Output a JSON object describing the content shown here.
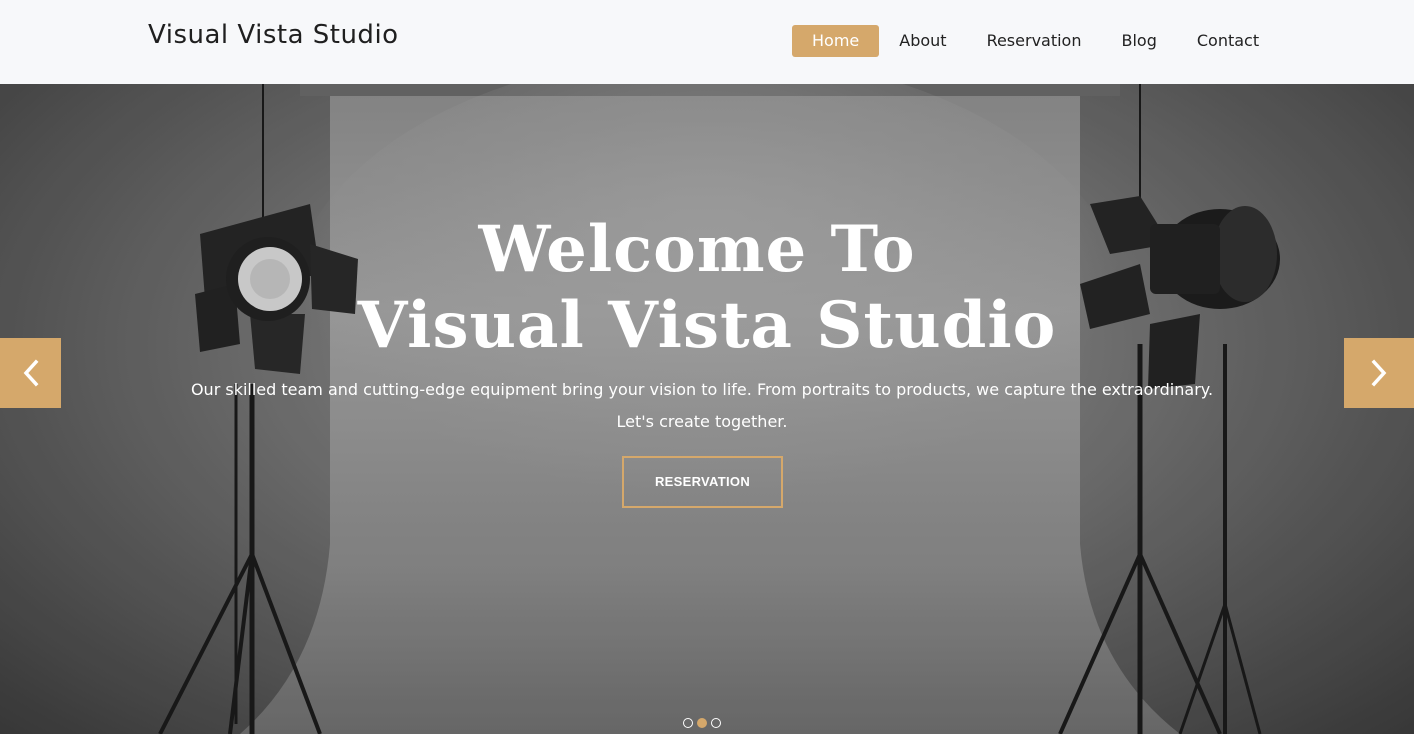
{
  "header": {
    "brand": "Visual Vista Studio",
    "nav": [
      {
        "label": "Home",
        "active": true
      },
      {
        "label": "About",
        "active": false
      },
      {
        "label": "Reservation",
        "active": false
      },
      {
        "label": "Blog",
        "active": false
      },
      {
        "label": "Contact",
        "active": false
      }
    ]
  },
  "hero": {
    "title_line1": "Welcome To",
    "title_line2": "Visual Vista Studio",
    "description": "Our skilled team and cutting-edge equipment bring your vision to life. From portraits to products, we capture the extraordinary. Let's create together.",
    "button_label": "RESERVATION",
    "prev_icon": "chevron-left-icon",
    "next_icon": "chevron-right-icon",
    "slides_total": 3,
    "active_slide": 2
  },
  "colors": {
    "accent": "#d5a86b",
    "header_bg": "#f7f8fa",
    "text_dark": "#222222"
  }
}
